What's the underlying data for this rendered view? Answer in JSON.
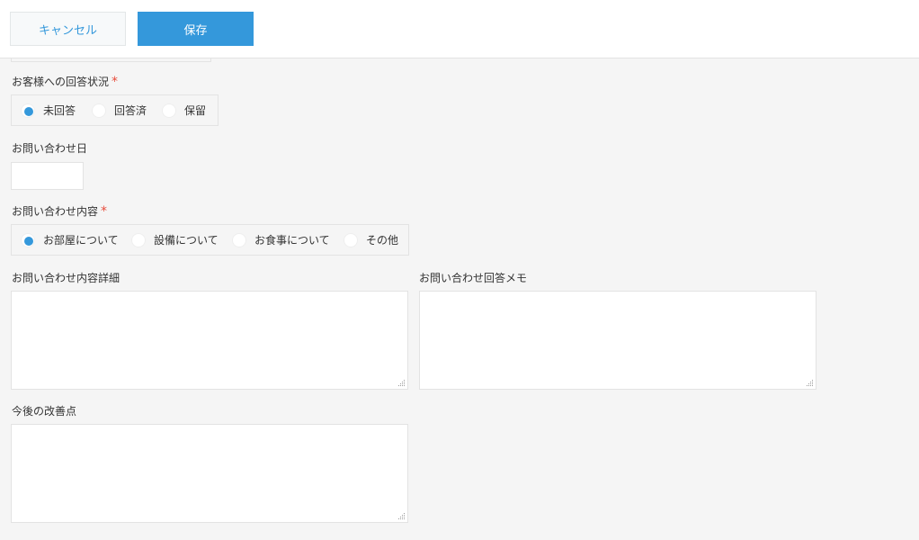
{
  "toolbar": {
    "cancel_label": "キャンセル",
    "save_label": "保存"
  },
  "fields": {
    "response_status": {
      "label": "お客様への回答状況",
      "required_mark": "*",
      "options": [
        "未回答",
        "回答済",
        "保留"
      ],
      "selected": "未回答"
    },
    "inquiry_date": {
      "label": "お問い合わせ日",
      "value": ""
    },
    "inquiry_content": {
      "label": "お問い合わせ内容",
      "required_mark": "*",
      "options": [
        "お部屋について",
        "設備について",
        "お食事について",
        "その他"
      ],
      "selected": "お部屋について"
    },
    "inquiry_detail": {
      "label": "お問い合わせ内容詳細",
      "value": ""
    },
    "reply_memo": {
      "label": "お問い合わせ回答メモ",
      "value": ""
    },
    "improvements": {
      "label": "今後の改善点",
      "value": ""
    }
  },
  "colors": {
    "accent": "#3498db",
    "required": "#e74c3c",
    "background": "#f5f5f5"
  }
}
